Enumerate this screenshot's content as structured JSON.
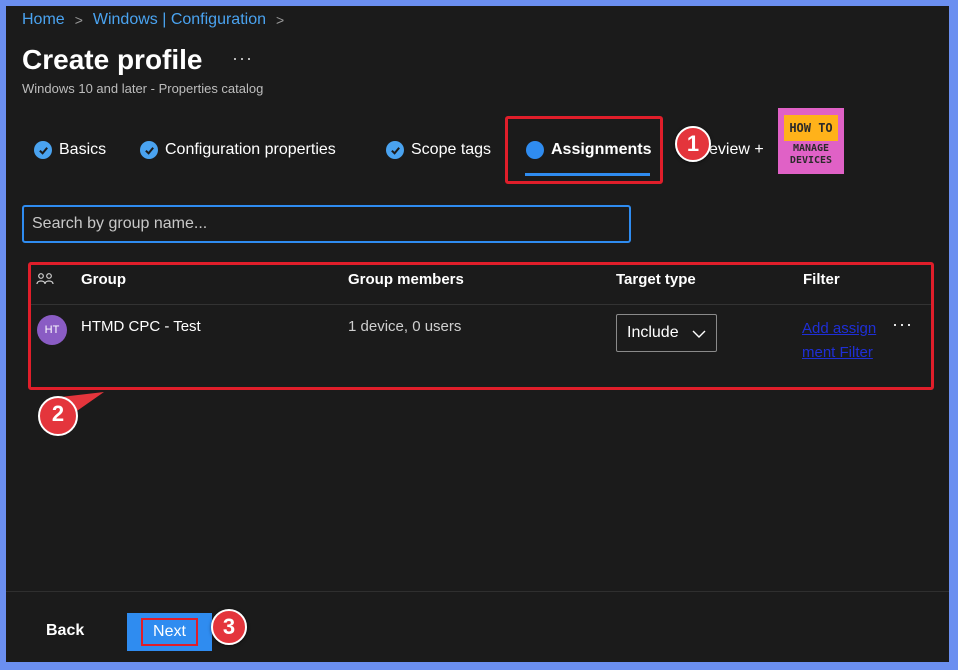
{
  "breadcrumb": {
    "items": [
      "Home",
      "Windows | Configuration"
    ]
  },
  "page": {
    "title": "Create profile",
    "more": "···",
    "subtitle": "Windows 10 and later - Properties catalog"
  },
  "tabs": [
    {
      "label": "Basics",
      "state": "complete"
    },
    {
      "label": "Configuration properties",
      "state": "complete"
    },
    {
      "label": "Scope tags",
      "state": "complete"
    },
    {
      "label": "Assignments",
      "state": "active"
    },
    {
      "label": "eview +",
      "state": "pending"
    }
  ],
  "logo": {
    "top": "HOW TO",
    "bottom_1": "MANAGE",
    "bottom_2": "DEVICES"
  },
  "search": {
    "placeholder": "Search by group name..."
  },
  "table": {
    "headers": {
      "group": "Group",
      "members": "Group members",
      "target": "Target type",
      "filter": "Filter"
    },
    "rows": [
      {
        "avatar": "HT",
        "group": "HTMD CPC - Test",
        "members": "1 device, 0 users",
        "target": "Include",
        "filter": "Add assignment Filter",
        "more": "···"
      }
    ]
  },
  "callouts": {
    "one": "1",
    "two": "2",
    "three": "3"
  },
  "footer": {
    "back": "Back",
    "next": "Next"
  },
  "colors": {
    "accent": "#2f8cf0",
    "link": "#4aa3f0",
    "callout": "#e4353c",
    "background": "#1b1b1b"
  }
}
